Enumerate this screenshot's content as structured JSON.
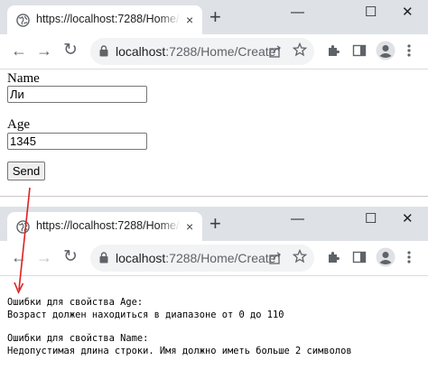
{
  "browser": {
    "tab_title": "https://localhost:7288/Home/Create",
    "tab_close": "×",
    "new_tab": "+",
    "url_host": "localhost",
    "url_path": ":7288/Home/Create",
    "minimize": "—",
    "maximize": "☐",
    "close": "✕",
    "back": "←",
    "forward": "→",
    "reload": "↻"
  },
  "form": {
    "name_label": "Name",
    "name_value": "Ли",
    "age_label": "Age",
    "age_value": "1345",
    "send_label": "Send"
  },
  "errors": {
    "age_header": "Ошибки для свойства Age:",
    "age_message": "Возраст должен находиться в диапазоне от 0 до 110",
    "name_header": "Ошибки для свойства Name:",
    "name_message": "Недопустимая длина строки. Имя должно иметь больше 2 символов"
  },
  "colors": {
    "arrow": "#e02020",
    "tabstrip": "#dee1e6",
    "omnibox": "#f1f3f4"
  }
}
